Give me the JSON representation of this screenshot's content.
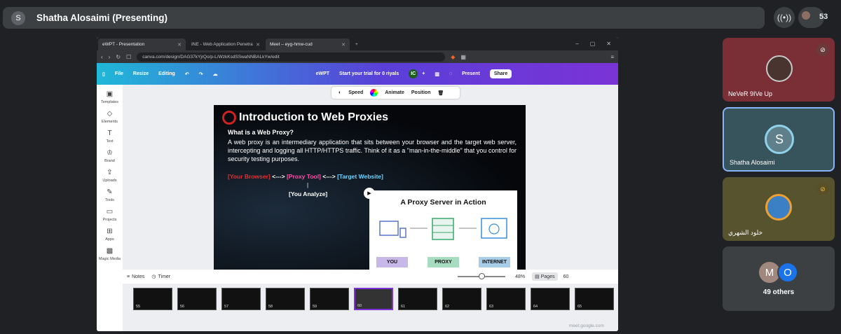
{
  "meet": {
    "presenter_initial": "S",
    "presenting_title": "Shatha Alosaimi (Presenting)",
    "participant_count": "53",
    "meet_url": "meet.google.com"
  },
  "browser": {
    "tabs": [
      {
        "label": "eWPT - Presentation"
      },
      {
        "label": "INE - Web Application Penetration Te"
      },
      {
        "label": "Meet – eyg-hmw-cud"
      }
    ],
    "url": "canva.com/design/DAG37kYjrQo/p-L/WzkKsdSSwaNNBALkYw/edit"
  },
  "canva": {
    "menu": {
      "file": "File",
      "resize": "Resize",
      "editing": "Editing",
      "doc_name": "eWPT",
      "trial": "Start your trial for 0 riyals",
      "avatar": "IC",
      "present": "Present",
      "share": "Share"
    },
    "sidebar": [
      {
        "label": "Templates"
      },
      {
        "label": "Elements"
      },
      {
        "label": "Text"
      },
      {
        "label": "Brand"
      },
      {
        "label": "Uploads"
      },
      {
        "label": "Tools"
      },
      {
        "label": "Projects"
      },
      {
        "label": "Apps"
      },
      {
        "label": "Magic Media"
      }
    ],
    "toolbar": {
      "speed": "Speed",
      "animate": "Animate",
      "position": "Position"
    },
    "slide": {
      "title": "Introduction to Web Proxies",
      "question": "What is a Web Proxy?",
      "paragraph": "A web proxy is an intermediary application that sits between your browser and the target web server, intercepting and logging all HTTP/HTTPS traffic. Think of it as a \"man-in-the-middle\" that you control for security testing purposes.",
      "flow_browser": "[Your Browser]",
      "flow_arrow1": " <---> ",
      "flow_tool": "[Proxy Tool]",
      "flow_arrow2": " <---> ",
      "flow_target": "[Target Website]",
      "flow_pipe": "|",
      "you_analyze": "[You Analyze]",
      "card_title": "A Proxy Server in Action",
      "card_you": "YOU",
      "card_proxy": "PROXY",
      "card_internet": "INTERNET"
    },
    "thumbnails": [
      "55",
      "56",
      "57",
      "58",
      "59",
      "60",
      "61",
      "62",
      "63",
      "64",
      "65"
    ],
    "selected_thumbnail": "60",
    "bottom": {
      "notes": "Notes",
      "timer": "Timer",
      "zoom": "48%",
      "pages": "Pages",
      "page_num": "60"
    }
  },
  "participants": [
    {
      "name": "NeVeR 9IVe Up",
      "muted": true
    },
    {
      "name": "Shatha Alosaimi",
      "initial": "S",
      "muted": false
    },
    {
      "name": "خلود الشهري",
      "muted": true
    },
    {
      "name": "49 others",
      "initials": [
        "M",
        "O"
      ]
    }
  ],
  "colors": {
    "accent_purple": "#7b33d6",
    "canva_teal": "#1fb8d8",
    "meet_bg": "#202124",
    "tile_bg": "#3c4043"
  }
}
